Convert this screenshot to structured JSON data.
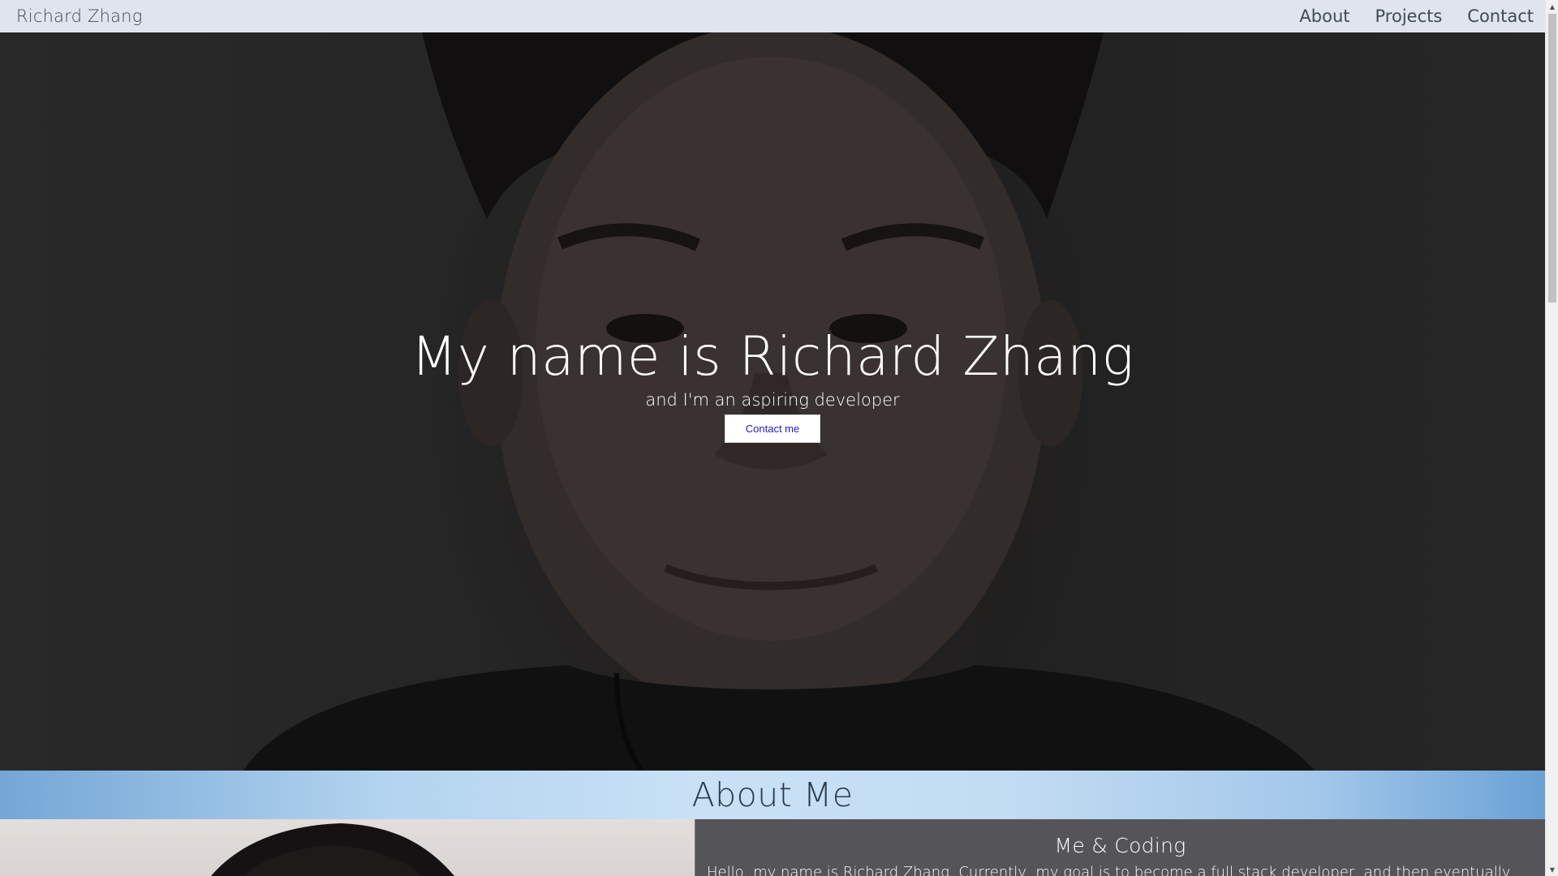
{
  "navbar": {
    "brand": "Richard Zhang",
    "links": [
      "About",
      "Projects",
      "Contact"
    ]
  },
  "hero": {
    "title": "My name is Richard Zhang",
    "subtitle": "and I'm an aspiring developer",
    "button_label": "Contact me"
  },
  "about": {
    "title": "About Me",
    "panel_heading": "Me & Coding",
    "panel_body": "Hello, my name is Richard Zhang. Currently, my goal is to become a full stack developer, and then eventually"
  },
  "colors": {
    "navbar_bg": "#dfe4ee",
    "nav_text": "#3f4a55",
    "hero_text": "#ffffff",
    "button_text": "#1d1dbd",
    "about_header_accent": "#c8e1f5",
    "text_panel_bg": "#555559"
  },
  "icons": {
    "scroll_up": "scroll-up-arrow-icon",
    "scroll_down": "scroll-down-arrow-icon"
  }
}
